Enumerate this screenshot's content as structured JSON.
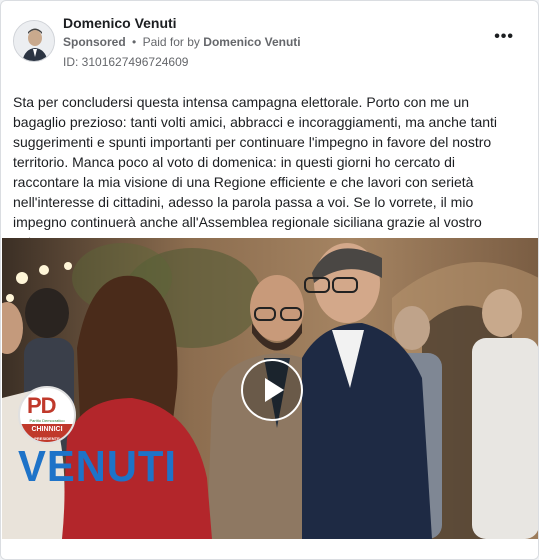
{
  "post": {
    "author": "Domenico Venuti",
    "sponsored_label": "Sponsored",
    "separator": "•",
    "paid_for_prefix": "Paid for by",
    "paid_for_name": "Domenico Venuti",
    "ad_id": "ID: 3101627496724609",
    "more_label": "•••",
    "body": "Sta per concludersi questa intensa campagna elettorale. Porto con me un bagaglio prezioso: tanti volti amici, abbracci e incoraggiamenti, ma anche tanti suggerimenti e spunti importanti per continuare l'impegno in favore del nostro territorio. Manca poco al voto di domenica: in questi giorni ho cercato di raccontare la mia visione di una Regione efficiente e che lavori con serietà nell'interesse di cittadini, adesso la parola passa a voi. Se lo vorrete, il mio impegno continuerà anche all'Assemblea regionale siciliana grazie al vostro voto…"
  },
  "media": {
    "type": "video",
    "play_icon": "play-icon",
    "logo": {
      "party_letters": "PD",
      "party_name": "Partito Democratico",
      "band_text": "CHINNICI",
      "band_subtext": "PRESIDENTE"
    },
    "overlay_name": "VENUTI"
  },
  "colors": {
    "accent_blue": "#1e73c8",
    "pd_red": "#c0392b",
    "text_secondary": "#65676b"
  }
}
